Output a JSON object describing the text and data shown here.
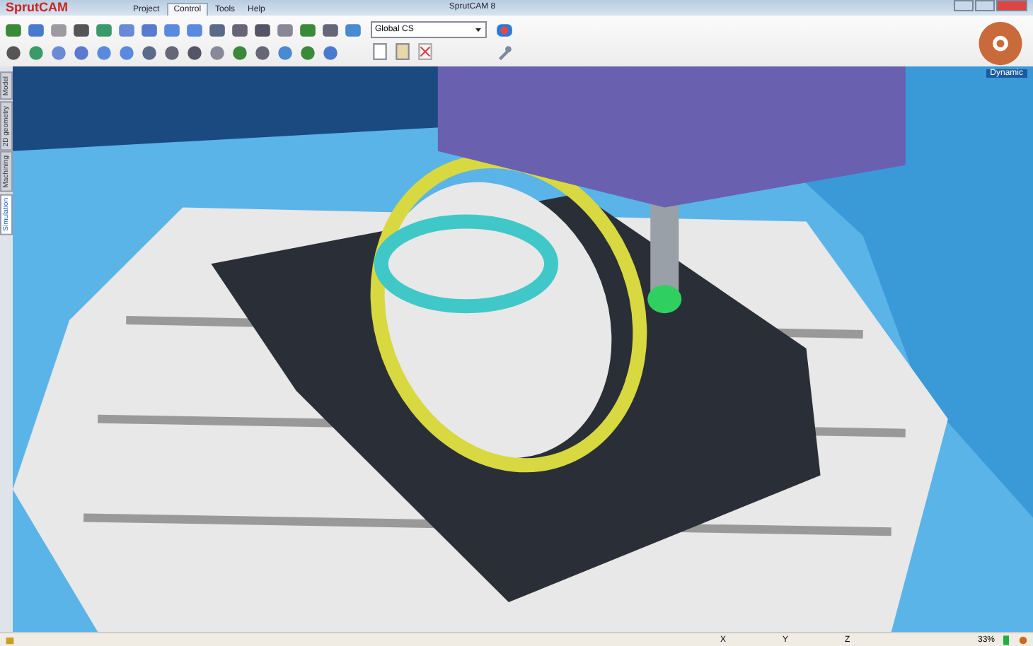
{
  "window": {
    "title": "SprutCAM 8",
    "logo": "SprutCAM"
  },
  "menu_tabs": [
    {
      "label": "Project",
      "selected": false
    },
    {
      "label": "Control",
      "selected": true
    },
    {
      "label": "Tools",
      "selected": false
    },
    {
      "label": "Help",
      "selected": false
    }
  ],
  "coordinate_system": {
    "value": "Global CS"
  },
  "side_tabs": [
    {
      "label": "Model",
      "selected": false
    },
    {
      "label": "2D geometry",
      "selected": false
    },
    {
      "label": "Machining",
      "selected": false
    },
    {
      "label": "Simulation",
      "selected": true
    }
  ],
  "viewport": {
    "mode_label": "Dynamic"
  },
  "status_bar": {
    "x_label": "X",
    "y_label": "Y",
    "z_label": "Z",
    "zoom": "33%"
  }
}
